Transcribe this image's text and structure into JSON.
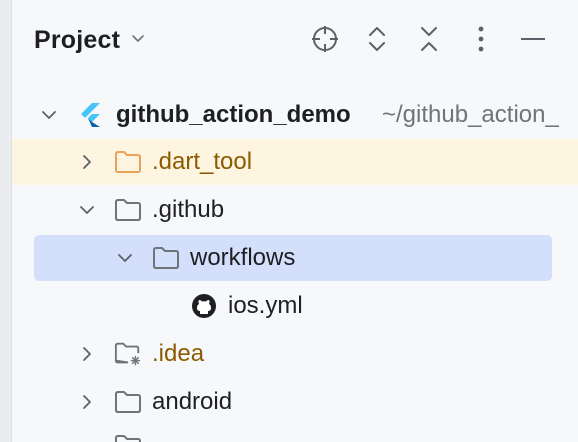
{
  "panel": {
    "title": "Project"
  },
  "toolbar": {
    "locate_icon": "crosshair-icon",
    "expand_icon": "expand-all-icon",
    "collapse_icon": "collapse-all-icon",
    "options_icon": "more-vertical-icon",
    "hide_icon": "minimize-icon"
  },
  "tree": {
    "root": {
      "label": "github_action_demo",
      "path": "~/github_action_",
      "icon": "flutter-icon"
    },
    "items": [
      {
        "label": ".dart_tool",
        "icon": "folder-icon",
        "state": "collapsed",
        "style": "excluded"
      },
      {
        "label": ".github",
        "icon": "folder-icon",
        "state": "expanded"
      },
      {
        "label": "workflows",
        "icon": "folder-icon",
        "state": "expanded",
        "selected": true
      },
      {
        "label": "ios.yml",
        "icon": "github-icon"
      },
      {
        "label": ".idea",
        "icon": "folder-settings-icon",
        "state": "collapsed",
        "style": "excluded"
      },
      {
        "label": "android",
        "icon": "folder-icon",
        "state": "collapsed"
      }
    ]
  },
  "colors": {
    "selection": "#d4e0fb",
    "excluded_row": "#fdf5e0",
    "excluded_text": "#8c5a00",
    "flutter": "#42a5f5",
    "folder_orange": "#e9a35b"
  }
}
